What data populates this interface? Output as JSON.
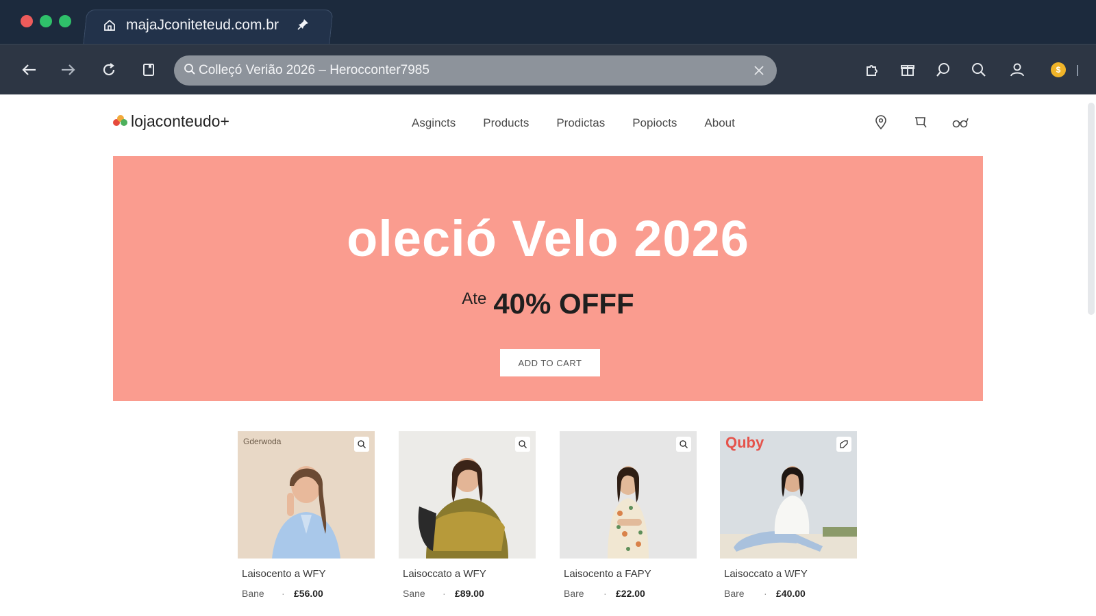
{
  "browser": {
    "tab_title": "majaJconiteteud.com.br",
    "address_value": "Colleçó Verião 2026 – Herocconter7985",
    "icons": [
      "back-icon",
      "forward-icon",
      "reload-icon",
      "bookmark-icon",
      "search-icon",
      "close-icon"
    ]
  },
  "site": {
    "logo_text": "lojaconteudo+",
    "nav": [
      "Asgincts",
      "Products",
      "Prodictas",
      "Popiocts",
      "About"
    ],
    "header_icons": [
      "location-icon",
      "cart-icon",
      "glasses-icon"
    ]
  },
  "hero": {
    "title": "oleció Velo 2026",
    "pre": "Ate",
    "offer": "40% OFFF",
    "button": "ADD TO CART",
    "bg_color": "#fa9c8f"
  },
  "products": [
    {
      "brand": "Gderwoda",
      "name": "Laisocento a WFY",
      "label": "Bane",
      "price": "£56.00"
    },
    {
      "brand": "",
      "name": "Laisoccato a WFY",
      "label": "Sane",
      "price": "£89.00"
    },
    {
      "brand": "",
      "name": "Laisocento a FAPY",
      "label": "Bare",
      "price": "£22.00"
    },
    {
      "brand": "Quby",
      "name": "Laisoccato a WFY",
      "label": "Bare",
      "price": "£40.00"
    }
  ]
}
